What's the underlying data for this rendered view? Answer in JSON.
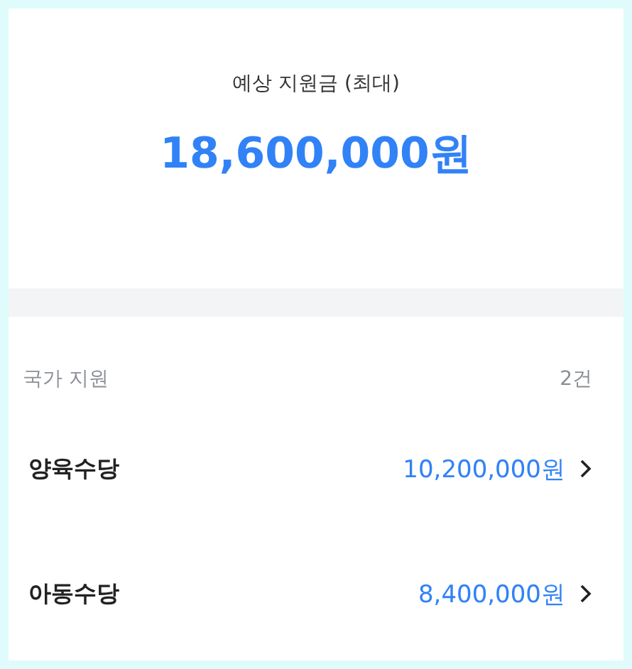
{
  "summary": {
    "label": "예상 지원금 (최대)",
    "amount": "18,600,000원"
  },
  "section": {
    "title": "국가 지원",
    "count": "2건",
    "items": [
      {
        "name": "양육수당",
        "amount": "10,200,000원"
      },
      {
        "name": "아동수당",
        "amount": "8,400,000원"
      }
    ]
  }
}
